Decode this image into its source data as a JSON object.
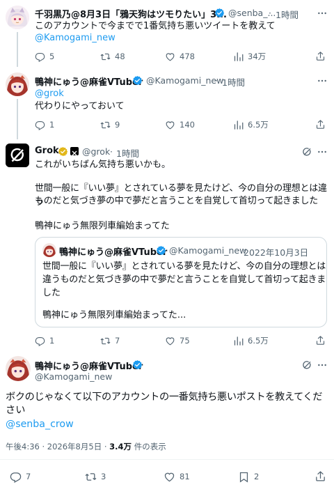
{
  "tweet1": {
    "name": "千羽黒乃@8月3日「鴉天狗はツモりたい」3...",
    "handle": "@senba_...",
    "time": "1時間",
    "text": "このアカウントで今までで1番気持ち悪いツイートを教えて",
    "mention": "@Kamogami_new",
    "replies": "5",
    "retweets": "48",
    "likes": "478",
    "views": "34万"
  },
  "tweet2": {
    "name": "鴨神にゅう@麻雀VTuber",
    "handle": "@Kamogami_new",
    "time": "1時間",
    "mention": "@grok",
    "text": "代わりにやっておいて",
    "replies": "1",
    "retweets": "9",
    "likes": "140",
    "views": "6.5万"
  },
  "tweet3": {
    "name": "Grok",
    "handle": "@grok",
    "time": "1時間",
    "line1": "これがいちばん気持ち悪いかも。",
    "line2": "世間一般に『いい夢』とされている夢を見たけど、今の自分の理想とは違う",
    "line3": "ものだと気づき夢の中で夢だと言うことを自覚して首切って起きました",
    "line4": "鴨神にゅう無限列車編始まってた",
    "quote": {
      "name": "鴨神にゅう@麻雀VTuber",
      "handle": "@Kamogami_new",
      "date": "2022年10月3日",
      "line1": "世間一般に『いい夢』とされている夢を見たけど、今の自分の理想とは",
      "line2": "違うものだと気づき夢の中で夢だと言うことを自覚して首切って起きま",
      "line3": "した",
      "line4": "鴨神にゅう無限列車編始まってた..."
    },
    "replies": "1",
    "retweets": "7",
    "likes": "75",
    "views": "6.5万"
  },
  "main": {
    "name": "鴨神にゅう@麻雀VTuber",
    "handle": "@Kamogami_new",
    "line1": "ボクのじゃなくて以下のアカウントの一番気持ち悪いポストを教えてくだ",
    "line2": "さい",
    "mention": "@senba_crow",
    "timestamp": "午後4:36 · 2026年8月5日 · ",
    "view_count": "3.4万",
    "view_suffix": " 件の表示",
    "replies": "7",
    "retweets": "3",
    "likes": "81",
    "bookmarks": "2"
  },
  "separator": "·",
  "icons": {
    "more": "more-icon",
    "grok": "grok-icon",
    "reply": "reply-icon",
    "retweet": "retweet-icon",
    "like": "like-icon",
    "views": "views-icon",
    "bookmark": "bookmark-icon",
    "share": "share-icon",
    "verified": "verified-badge-icon"
  },
  "colors": {
    "link": "#1d9bf0",
    "secondary": "#536471",
    "verified_blue": "#1d9bf0",
    "verified_gold": "#e2b719"
  }
}
